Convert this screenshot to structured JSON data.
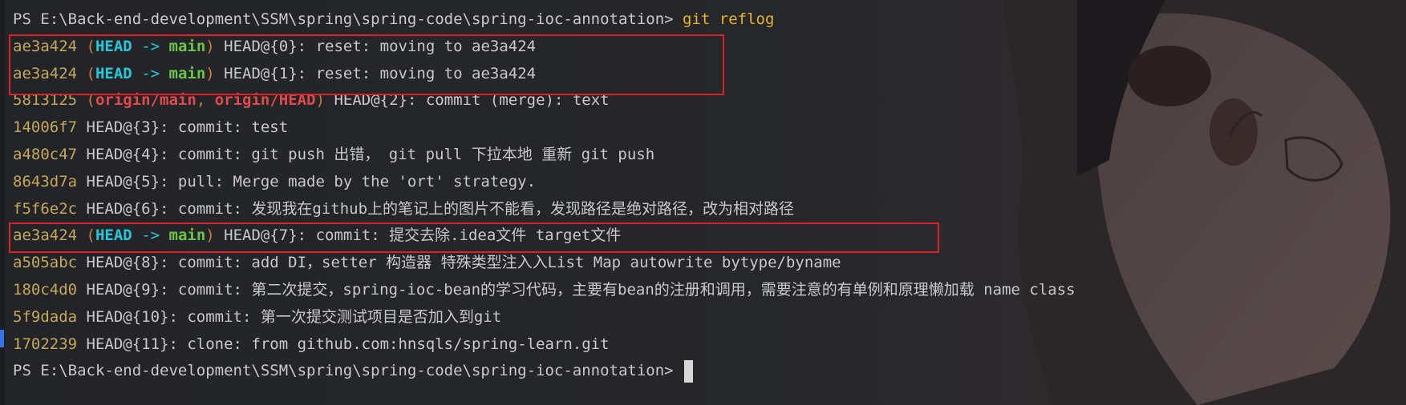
{
  "prompt": {
    "text": "PS E:\\Back-end-development\\SSM\\spring\\spring-code\\spring-ioc-annotation>",
    "command": " git reflog"
  },
  "entries": [
    {
      "hash": "ae3a424",
      "refs": {
        "type": "head-main",
        "open": "(",
        "head": "HEAD",
        "arrow": " -> ",
        "branch": "main",
        "close": ")"
      },
      "message": " HEAD@{0}: reset: moving to ae3a424"
    },
    {
      "hash": "ae3a424",
      "refs": {
        "type": "head-main",
        "open": "(",
        "head": "HEAD",
        "arrow": " -> ",
        "branch": "main",
        "close": ")"
      },
      "message": " HEAD@{1}: reset: moving to ae3a424"
    },
    {
      "hash": "5813125",
      "refs": {
        "type": "origin",
        "open": "(",
        "origin_main": "origin/main",
        "sep": ", ",
        "origin_head": "origin/HEAD",
        "close": ")"
      },
      "message": " HEAD@{2}: commit (merge): text"
    },
    {
      "hash": "14006f7",
      "refs": null,
      "message": " HEAD@{3}: commit: test"
    },
    {
      "hash": "a480c47",
      "refs": null,
      "message": " HEAD@{4}: commit: git push 出错， git pull 下拉本地 重新 git push"
    },
    {
      "hash": "8643d7a",
      "refs": null,
      "message": " HEAD@{5}: pull: Merge made by the 'ort' strategy."
    },
    {
      "hash": "f5f6e2c",
      "refs": null,
      "message": " HEAD@{6}: commit: 发现我在github上的笔记上的图片不能看，发现路径是绝对路径，改为相对路径"
    },
    {
      "hash": "ae3a424",
      "refs": {
        "type": "head-main",
        "open": "(",
        "head": "HEAD",
        "arrow": " -> ",
        "branch": "main",
        "close": ")"
      },
      "message": " HEAD@{7}: commit: 提交去除.idea文件 target文件"
    },
    {
      "hash": "a505abc",
      "refs": null,
      "message": " HEAD@{8}: commit: add DI，setter 构造器 特殊类型注入入List Map autowrite bytype/byname"
    },
    {
      "hash": "180c4d0",
      "refs": null,
      "message": " HEAD@{9}: commit: 第二次提交，spring-ioc-bean的学习代码，主要有bean的注册和调用，需要注意的有单例和原理懒加载 name class"
    },
    {
      "hash": "5f9dada",
      "refs": null,
      "message": " HEAD@{10}: commit: 第一次提交测试项目是否加入到git"
    },
    {
      "hash": "1702239",
      "refs": null,
      "message": " HEAD@{11}: clone: from github.com:hnsqls/spring-learn.git"
    }
  ],
  "final_prompt": {
    "text": "PS E:\\Back-end-development\\SSM\\spring\\spring-code\\spring-ioc-annotation>"
  },
  "colors": {
    "background": "#232428",
    "hash": "#c4a85a",
    "head": "#24c8d8",
    "main": "#6cc644",
    "origin": "#e04a4a",
    "command": "#e6b422",
    "highlight_box": "#d8232a"
  },
  "icons": {
    "cursor": "block-cursor"
  }
}
